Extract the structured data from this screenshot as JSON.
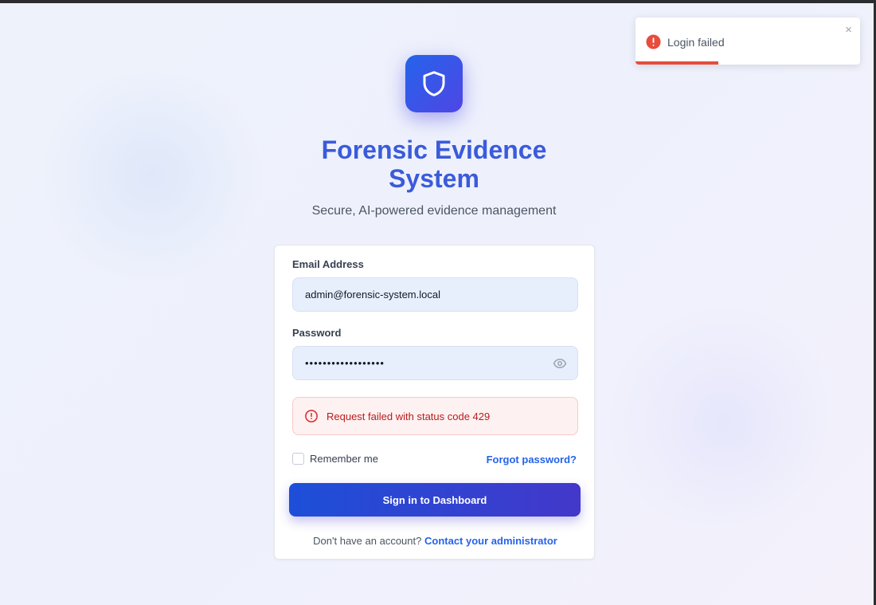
{
  "app": {
    "title": "Forensic Evidence System",
    "subtitle": "Secure, AI-powered evidence management"
  },
  "form": {
    "email_label": "Email Address",
    "email_value": "admin@forensic-system.local",
    "password_label": "Password",
    "password_value": "••••••••••••••••••",
    "error_message": "Request failed with status code 429",
    "remember_label": "Remember me",
    "remember_checked": false,
    "forgot_link": "Forgot password?",
    "submit_label": "Sign in to Dashboard",
    "footer_prefix": "Don't have an account?",
    "footer_link": "Contact your administrator"
  },
  "toast": {
    "message": "Login failed",
    "close_symbol": "×",
    "progress_fraction": 0.37
  },
  "icons": {
    "logo": "shield-icon",
    "password_toggle": "eye-icon",
    "error": "alert-circle-icon",
    "toast": "error-icon"
  },
  "colors": {
    "accent": "#3b5bdb",
    "button_start": "#1d4fd8",
    "button_end": "#4338ca",
    "error": "#b91c1c",
    "toast_progress": "#e74c3c"
  }
}
